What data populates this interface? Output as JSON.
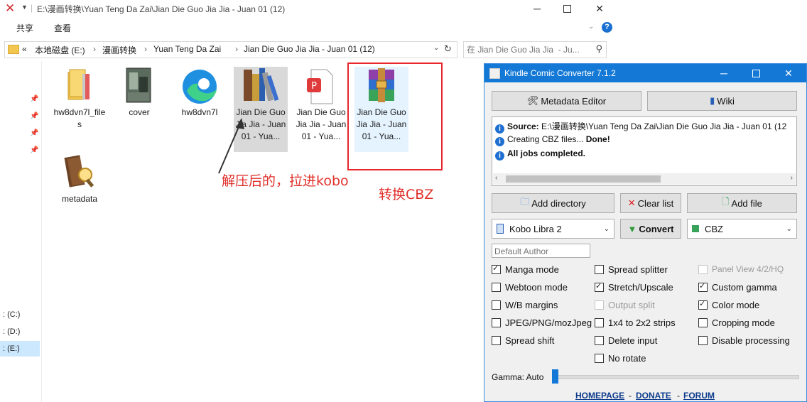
{
  "explorer": {
    "title": "E:\\漫画转换\\Yuan Teng Da Zai\\Jian Die Guo Jia Jia  - Juan 01 (12)",
    "ribbon_tabs": [
      "共享",
      "查看"
    ],
    "breadcrumb": [
      "«",
      "本地磁盘 (E:)",
      "›",
      "漫画转换",
      "›",
      "Yuan Teng Da Zai",
      "›",
      "Jian Die Guo Jia Jia  - Juan 01 (12)"
    ],
    "search_placeholder": "在 Jian Die Guo Jia Jia  - Ju...",
    "drives": [
      ": (C:)",
      ": (D:)",
      ": (E:)"
    ],
    "files": [
      {
        "name": "hw8dvn7l_files",
        "icon": "folder-icon"
      },
      {
        "name": "cover",
        "icon": "image-icon"
      },
      {
        "name": "hw8dvn7l",
        "icon": "edge-icon"
      },
      {
        "name": "Jian Die Guo Jia Jia  - Juan 01 - Yua...",
        "icon": "calibre-icon"
      },
      {
        "name": "Jian Die Guo Jia Jia  - Juan 01 - Yua...",
        "icon": "pdf-icon"
      },
      {
        "name": "Jian Die Guo Jia Jia  - Juan 01 - Yua...",
        "icon": "winrar-icon"
      },
      {
        "name": "metadata",
        "icon": "metadata-icon"
      }
    ],
    "annotation_left": "解压后的，拉进kobo",
    "annotation_right": "转换CBZ"
  },
  "kcc": {
    "title": "Kindle Comic Converter 7.1.2",
    "metadata_editor": "Metadata Editor",
    "wiki": "Wiki",
    "log": {
      "source_label": "Source:",
      "source_path": "E:\\漫画转换\\Yuan Teng Da Zai\\Jian Die Guo Jia Jia  - Juan 01 (12",
      "creating": "Creating CBZ files...",
      "done": "Done!",
      "completed": "All jobs completed."
    },
    "add_directory": "Add directory",
    "clear_list": "Clear list",
    "add_file": "Add file",
    "device": "Kobo Libra 2",
    "convert": "Convert",
    "format": "CBZ",
    "author_placeholder": "Default Author",
    "options": [
      {
        "label": "Manga mode",
        "checked": true,
        "disabled": false
      },
      {
        "label": "Spread splitter",
        "checked": false,
        "disabled": false
      },
      {
        "label": "Panel View 4/2/HQ",
        "checked": false,
        "disabled": true
      },
      {
        "label": "Webtoon mode",
        "checked": false,
        "disabled": false
      },
      {
        "label": "Stretch/Upscale",
        "checked": true,
        "disabled": false
      },
      {
        "label": "Custom gamma",
        "checked": true,
        "disabled": false
      },
      {
        "label": "W/B margins",
        "checked": false,
        "disabled": false
      },
      {
        "label": "Output split",
        "checked": false,
        "disabled": true
      },
      {
        "label": "Color mode",
        "checked": true,
        "disabled": false
      },
      {
        "label": "JPEG/PNG/mozJpeg",
        "checked": false,
        "disabled": false
      },
      {
        "label": "1x4 to 2x2 strips",
        "checked": false,
        "disabled": false
      },
      {
        "label": "Cropping mode",
        "checked": false,
        "disabled": false
      },
      {
        "label": "Spread shift",
        "checked": false,
        "disabled": false
      },
      {
        "label": "Delete input",
        "checked": false,
        "disabled": false
      },
      {
        "label": "Disable processing",
        "checked": false,
        "disabled": false
      },
      {
        "label": "No rotate",
        "checked": false,
        "disabled": false
      }
    ],
    "gamma_label": "Gamma: Auto",
    "footer": {
      "homepage": "HOMEPAGE",
      "sep1": "-",
      "donate": "DONATE",
      "sep2": "-",
      "forum": "FORUM"
    }
  }
}
